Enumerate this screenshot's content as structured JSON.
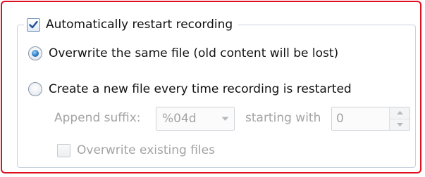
{
  "group": {
    "header_label": "Automatically restart recording",
    "header_checked": true
  },
  "options": {
    "overwrite_label": "Overwrite the same file (old content will be lost)",
    "create_new_label": "Create a new file every time recording is restarted",
    "selected": "overwrite"
  },
  "append": {
    "label": "Append suffix:",
    "value": "%04d"
  },
  "starting": {
    "label": "starting with",
    "value": "0"
  },
  "overwrite_existing": {
    "label": "Overwrite existing files",
    "checked": false
  },
  "colors": {
    "highlight": "#e01020",
    "disabled_text": "#a3a3a3",
    "radio_selected": "#2a7cc8"
  }
}
